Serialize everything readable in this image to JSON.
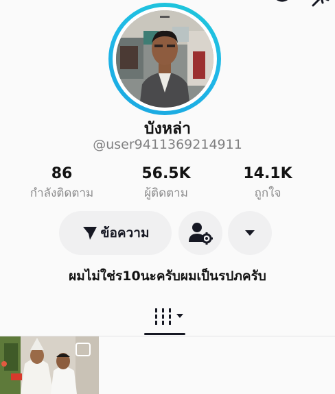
{
  "profile": {
    "display_name": "บังหล่า",
    "username": "@user9411369214911",
    "bio": "ผมไม่ใช่ร10นะครับผมเป็นรปภครับ"
  },
  "stats": {
    "following": {
      "value": "86",
      "label": "กำลังติดตาม"
    },
    "followers": {
      "value": "56.5K",
      "label": "ผู้ติดตาม"
    },
    "likes": {
      "value": "14.1K",
      "label": "ถูกใจ"
    }
  },
  "actions": {
    "message_label": "ข้อความ"
  },
  "icons": {
    "top_left": "history-icon",
    "top_right": "share-icon",
    "message": "send-icon",
    "friend": "user-settings-icon",
    "more": "caret-down-icon",
    "tab": "videos-grid-icon"
  },
  "colors": {
    "avatar_ring": "#1ec8d8",
    "text_primary": "#161823",
    "text_secondary": "#8a8a8b",
    "button_bg": "#f0f0f1"
  }
}
